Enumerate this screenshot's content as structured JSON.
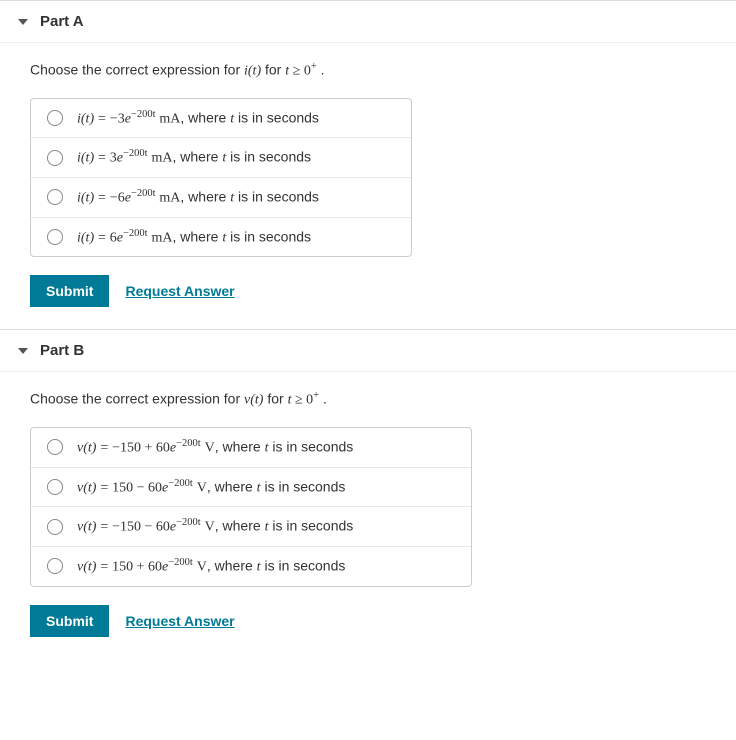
{
  "parts": [
    {
      "title": "Part A",
      "prompt_prefix": "Choose the correct expression for ",
      "prompt_func": "i(t)",
      "prompt_mid": " for ",
      "prompt_cond_lhs": "t",
      "prompt_cond_op": "≥",
      "prompt_cond_rhs": "0",
      "prompt_cond_sup": "+",
      "prompt_suffix": " .",
      "options": [
        {
          "func": "i(t)",
          "eq": "=",
          "coef": "−3",
          "base": "e",
          "exp": "−200t",
          "sp": " ",
          "unit": "mA",
          "tail": ", where ",
          "tvar": "t",
          "tail2": " is in seconds"
        },
        {
          "func": "i(t)",
          "eq": "=",
          "coef": "3",
          "base": "e",
          "exp": "−200t",
          "sp": " ",
          "unit": "mA",
          "tail": ", where ",
          "tvar": "t",
          "tail2": " is in seconds"
        },
        {
          "func": "i(t)",
          "eq": "=",
          "coef": "−6",
          "base": "e",
          "exp": "−200t",
          "sp": " ",
          "unit": "mA",
          "tail": ", where ",
          "tvar": "t",
          "tail2": " is in seconds"
        },
        {
          "func": "i(t)",
          "eq": "=",
          "coef": "6",
          "base": "e",
          "exp": "−200t",
          "sp": " ",
          "unit": "mA",
          "tail": ", where ",
          "tvar": "t",
          "tail2": " is in seconds"
        }
      ],
      "submit_label": "Submit",
      "request_label": "Request Answer"
    },
    {
      "title": "Part B",
      "prompt_prefix": "Choose the correct expression for ",
      "prompt_func": "v(t)",
      "prompt_mid": " for ",
      "prompt_cond_lhs": "t",
      "prompt_cond_op": "≥",
      "prompt_cond_rhs": "0",
      "prompt_cond_sup": "+",
      "prompt_suffix": " .",
      "options": [
        {
          "func": "v(t)",
          "eq": "=",
          "coef": "−150 + 60",
          "base": "e",
          "exp": "−200t",
          "sp": " ",
          "unit": "V",
          "tail": ", where ",
          "tvar": "t",
          "tail2": " is in seconds"
        },
        {
          "func": "v(t)",
          "eq": "=",
          "coef": "150 − 60",
          "base": "e",
          "exp": "−200t",
          "sp": " ",
          "unit": "V",
          "tail": ", where ",
          "tvar": "t",
          "tail2": " is in seconds"
        },
        {
          "func": "v(t)",
          "eq": "=",
          "coef": "−150 − 60",
          "base": "e",
          "exp": "−200t",
          "sp": " ",
          "unit": "V",
          "tail": ", where ",
          "tvar": "t",
          "tail2": " is in seconds"
        },
        {
          "func": "v(t)",
          "eq": "=",
          "coef": "150 + 60",
          "base": "e",
          "exp": "−200t",
          "sp": " ",
          "unit": "V",
          "tail": ", where ",
          "tvar": "t",
          "tail2": " is in seconds"
        }
      ],
      "submit_label": "Submit",
      "request_label": "Request Answer"
    }
  ]
}
